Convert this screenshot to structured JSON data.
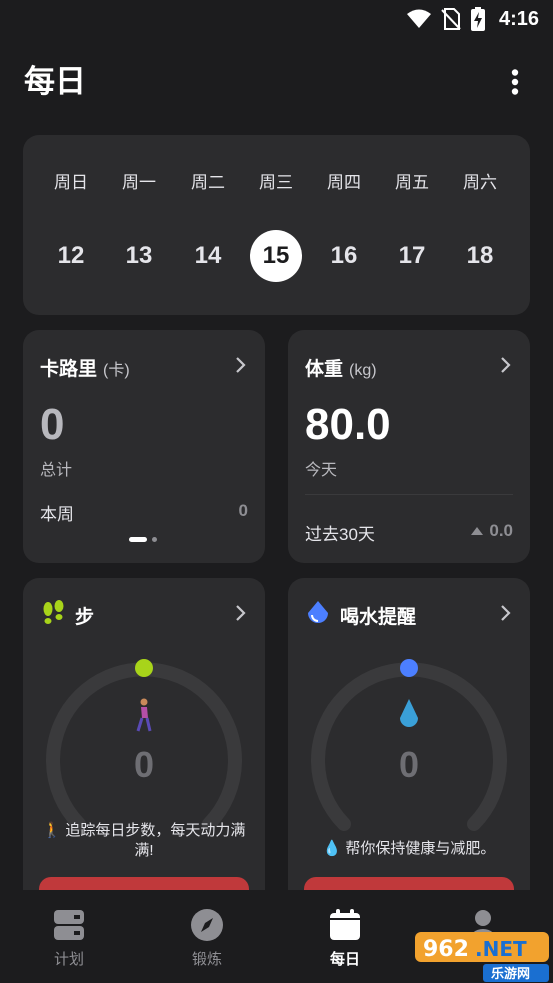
{
  "status_bar": {
    "time": "4:16"
  },
  "header": {
    "title": "每日"
  },
  "calendar": {
    "weekdays": [
      "周日",
      "周一",
      "周二",
      "周三",
      "周四",
      "周五",
      "周六"
    ],
    "dates": [
      "12",
      "13",
      "14",
      "15",
      "16",
      "17",
      "18"
    ],
    "selected_index": 3
  },
  "calories": {
    "title": "卡路里",
    "unit": "(卡)",
    "value": "0",
    "total_label": "总计",
    "week_label": "本周",
    "week_value": "0",
    "page_dots": {
      "count": 2,
      "active": 0
    }
  },
  "weight": {
    "title": "体重",
    "unit": "(kg)",
    "value": "80.0",
    "today_label": "今天",
    "past_label": "过去30天",
    "past_value": "0.0"
  },
  "steps": {
    "title": "步",
    "value": "0",
    "tip": "🚶 追踪每日步数，每天动力满满!",
    "accent": "#a8d41a"
  },
  "water": {
    "title": "喝水提醒",
    "value": "0",
    "tip": "💧 帮你保持健康与减肥。",
    "accent": "#4c7fff"
  },
  "tabs": [
    {
      "label": "计划",
      "icon": "plan-icon"
    },
    {
      "label": "锻炼",
      "icon": "compass-icon"
    },
    {
      "label": "每日",
      "icon": "calendar-icon",
      "active": true
    },
    {
      "label": "",
      "icon": "profile-icon"
    }
  ],
  "watermark": {
    "text": "962.NET",
    "subtext": "乐游网"
  },
  "colors": {
    "background": "#1c1c1e",
    "card": "#2c2c2e",
    "action_red": "#c0393b"
  }
}
